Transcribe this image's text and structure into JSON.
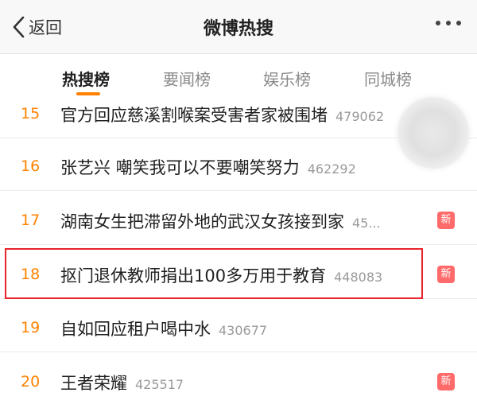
{
  "navbar": {
    "back_label": "返回",
    "title": "微博热搜"
  },
  "tabs": [
    {
      "label": "热搜榜",
      "active": true
    },
    {
      "label": "要闻榜",
      "active": false
    },
    {
      "label": "娱乐榜",
      "active": false
    },
    {
      "label": "同城榜",
      "active": false
    }
  ],
  "list": {
    "rows": [
      {
        "rank": "15",
        "topic": "官方回应慈溪割喉案受害者家被围堵",
        "count": "479062",
        "badge": ""
      },
      {
        "rank": "16",
        "topic": "张艺兴 嘲笑我可以不要嘲笑努力",
        "count": "462292",
        "badge": ""
      },
      {
        "rank": "17",
        "topic": "湖南女生把滞留外地的武汉女孩接到家",
        "count": "45...",
        "badge": "新"
      },
      {
        "rank": "18",
        "topic": "抠门退休教师捐出100多万用于教育",
        "count": "448083",
        "badge": "新"
      },
      {
        "rank": "19",
        "topic": "自如回应租户喝中水",
        "count": "430677",
        "badge": ""
      },
      {
        "rank": "20",
        "topic": "王者荣耀",
        "count": "425517",
        "badge": "新"
      }
    ]
  },
  "colors": {
    "rank": "#ff8200",
    "badge": "#ff6b6b",
    "highlight_border": "#e8242c",
    "tab_underline": "#ff8200"
  },
  "icons": {
    "back": "chevron-left-icon",
    "more": "more-dots-icon"
  }
}
